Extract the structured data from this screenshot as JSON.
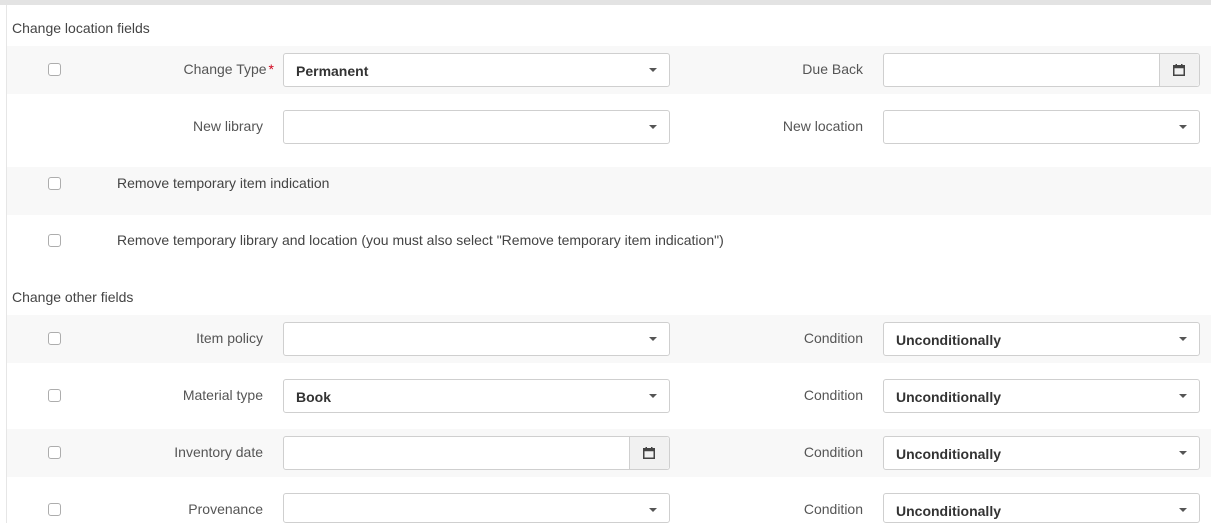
{
  "location_section": {
    "title": "Change location fields",
    "change_type_label": "Change Type",
    "required_mark": "*",
    "change_type_value": "Permanent",
    "due_back_label": "Due Back",
    "due_back_value": "",
    "new_library_label": "New library",
    "new_library_value": "",
    "new_location_label": "New location",
    "new_location_value": "",
    "remove_temp_item_label": "Remove temporary item indication",
    "remove_temp_lib_label": "Remove temporary library and location (you must also select \"Remove temporary item indication\")"
  },
  "other_section": {
    "title": "Change other fields",
    "rows": [
      {
        "label": "Item policy",
        "value": "",
        "condition_label": "Condition",
        "condition_value": "Unconditionally"
      },
      {
        "label": "Material type",
        "value": "Book",
        "condition_label": "Condition",
        "condition_value": "Unconditionally"
      },
      {
        "label": "Inventory date",
        "value": "",
        "condition_label": "Condition",
        "condition_value": "Unconditionally"
      },
      {
        "label": "Provenance",
        "value": "",
        "condition_label": "Condition",
        "condition_value": "Unconditionally"
      }
    ]
  },
  "icons": {
    "caret": "chevron-down-icon",
    "calendar": "calendar-icon"
  },
  "colors": {
    "required": "#d0021b",
    "band": "#f8f8f8",
    "border": "#cfcfcf"
  }
}
